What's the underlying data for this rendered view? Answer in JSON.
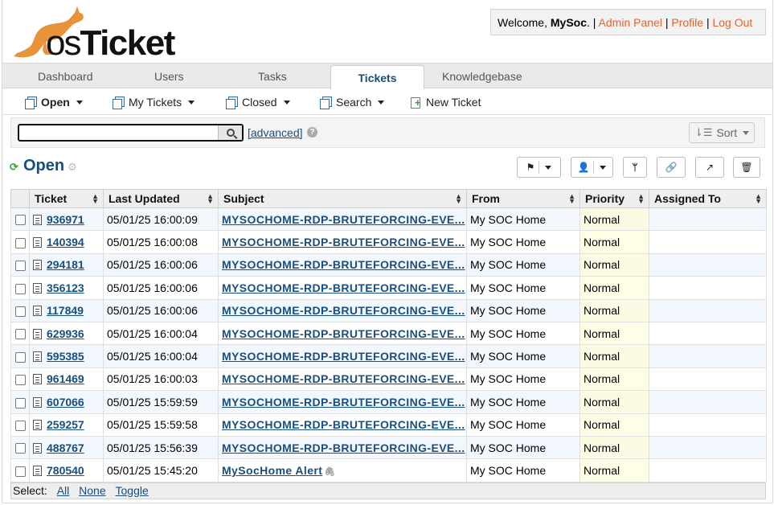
{
  "header": {
    "logo_text_os": "os",
    "logo_text_ticket": "Ticket",
    "welcome_prefix": "Welcome,",
    "username": "MySoc",
    "welcome_suffix": ". |",
    "admin_panel": "Admin Panel",
    "profile": "Profile",
    "logout": "Log Out",
    "sep": "|"
  },
  "tabs": [
    "Dashboard",
    "Users",
    "Tasks",
    "Tickets",
    "Knowledgebase"
  ],
  "subnav": {
    "open": "Open",
    "my_tickets": "My Tickets",
    "closed": "Closed",
    "search": "Search",
    "new_ticket": "New Ticket"
  },
  "searchbar": {
    "query": "",
    "advanced": "[advanced]",
    "help": "?",
    "sort": "Sort"
  },
  "queue": {
    "title": "Open"
  },
  "table": {
    "columns": [
      "Ticket",
      "Last Updated",
      "Subject",
      "From",
      "Priority",
      "Assigned To"
    ],
    "rows": [
      {
        "ticket": "936971",
        "updated": "05/01/25 16:00:09",
        "subject": "MYSOCHOME-RDP-BRUTEFORCING-EVE...",
        "from": "My SOC Home",
        "priority": "Normal",
        "assigned": ""
      },
      {
        "ticket": "140394",
        "updated": "05/01/25 16:00:08",
        "subject": "MYSOCHOME-RDP-BRUTEFORCING-EVE...",
        "from": "My SOC Home",
        "priority": "Normal",
        "assigned": ""
      },
      {
        "ticket": "294181",
        "updated": "05/01/25 16:00:06",
        "subject": "MYSOCHOME-RDP-BRUTEFORCING-EVE...",
        "from": "My SOC Home",
        "priority": "Normal",
        "assigned": ""
      },
      {
        "ticket": "356123",
        "updated": "05/01/25 16:00:06",
        "subject": "MYSOCHOME-RDP-BRUTEFORCING-EVE...",
        "from": "My SOC Home",
        "priority": "Normal",
        "assigned": ""
      },
      {
        "ticket": "117849",
        "updated": "05/01/25 16:00:06",
        "subject": "MYSOCHOME-RDP-BRUTEFORCING-EVE...",
        "from": "My SOC Home",
        "priority": "Normal",
        "assigned": ""
      },
      {
        "ticket": "629936",
        "updated": "05/01/25 16:00:04",
        "subject": "MYSOCHOME-RDP-BRUTEFORCING-EVE...",
        "from": "My SOC Home",
        "priority": "Normal",
        "assigned": ""
      },
      {
        "ticket": "595385",
        "updated": "05/01/25 16:00:04",
        "subject": "MYSOCHOME-RDP-BRUTEFORCING-EVE...",
        "from": "My SOC Home",
        "priority": "Normal",
        "assigned": ""
      },
      {
        "ticket": "961469",
        "updated": "05/01/25 16:00:03",
        "subject": "MYSOCHOME-RDP-BRUTEFORCING-EVE...",
        "from": "My SOC Home",
        "priority": "Normal",
        "assigned": ""
      },
      {
        "ticket": "607066",
        "updated": "05/01/25 15:59:59",
        "subject": "MYSOCHOME-RDP-BRUTEFORCING-EVE...",
        "from": "My SOC Home",
        "priority": "Normal",
        "assigned": ""
      },
      {
        "ticket": "259257",
        "updated": "05/01/25 15:59:58",
        "subject": "MYSOCHOME-RDP-BRUTEFORCING-EVE...",
        "from": "My SOC Home",
        "priority": "Normal",
        "assigned": ""
      },
      {
        "ticket": "488767",
        "updated": "05/01/25 15:56:39",
        "subject": "MYSOCHOME-RDP-BRUTEFORCING-EVE...",
        "from": "My SOC Home",
        "priority": "Normal",
        "assigned": ""
      },
      {
        "ticket": "780540",
        "updated": "05/01/25 15:45:20",
        "subject": "MySocHome Alert",
        "from": "My SOC Home",
        "priority": "Normal",
        "assigned": "",
        "attachment": true
      }
    ]
  },
  "footer": {
    "select_label": "Select:",
    "all": "All",
    "none": "None",
    "toggle": "Toggle"
  },
  "colors": {
    "brand_orange": "#e2642a",
    "link_blue": "#184e81",
    "row_alt": "#f1f7fc",
    "priority_bg": "#fefde6"
  }
}
